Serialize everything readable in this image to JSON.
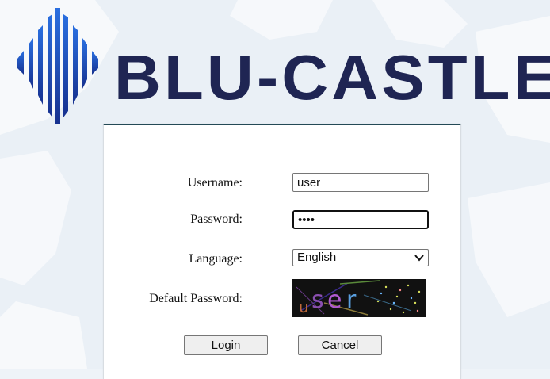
{
  "brand": {
    "name": "BLU-CASTLE",
    "icon": "castle-wave-logo-icon",
    "color": "#1f2553",
    "accent": "#1e5fd6"
  },
  "login_form": {
    "username": {
      "label": "Username:",
      "value": "user"
    },
    "password": {
      "label": "Password:",
      "value": "••••"
    },
    "language": {
      "label": "Language:",
      "selected": "English"
    },
    "default_password": {
      "label": "Default Password:",
      "captcha_text": "user"
    },
    "login_label": "Login",
    "cancel_label": "Cancel"
  }
}
